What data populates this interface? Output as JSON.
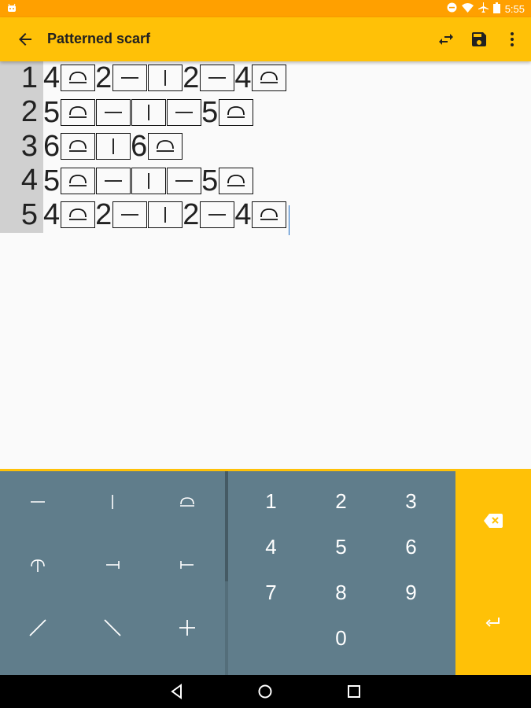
{
  "status": {
    "time": "5:55"
  },
  "toolbar": {
    "title": "Patterned scarf"
  },
  "pattern": {
    "rows": [
      {
        "num": "1",
        "cells": [
          {
            "t": "n",
            "v": "4"
          },
          {
            "t": "s",
            "k": "purl"
          },
          {
            "t": "n",
            "v": "2"
          },
          {
            "t": "s",
            "k": "dash"
          },
          {
            "t": "s",
            "k": "bar"
          },
          {
            "t": "n",
            "v": "2"
          },
          {
            "t": "s",
            "k": "dash"
          },
          {
            "t": "n",
            "v": "4"
          },
          {
            "t": "s",
            "k": "purl"
          }
        ]
      },
      {
        "num": "2",
        "cells": [
          {
            "t": "n",
            "v": "5"
          },
          {
            "t": "s",
            "k": "purl"
          },
          {
            "t": "s",
            "k": "dash"
          },
          {
            "t": "s",
            "k": "bar"
          },
          {
            "t": "s",
            "k": "dash"
          },
          {
            "t": "n",
            "v": "5"
          },
          {
            "t": "s",
            "k": "purl"
          }
        ]
      },
      {
        "num": "3",
        "cells": [
          {
            "t": "n",
            "v": "6"
          },
          {
            "t": "s",
            "k": "purl"
          },
          {
            "t": "s",
            "k": "bar"
          },
          {
            "t": "n",
            "v": "6"
          },
          {
            "t": "s",
            "k": "purl"
          }
        ]
      },
      {
        "num": "4",
        "cells": [
          {
            "t": "n",
            "v": "5"
          },
          {
            "t": "s",
            "k": "purl"
          },
          {
            "t": "s",
            "k": "dash"
          },
          {
            "t": "s",
            "k": "bar"
          },
          {
            "t": "s",
            "k": "dash"
          },
          {
            "t": "n",
            "v": "5"
          },
          {
            "t": "s",
            "k": "purl"
          }
        ]
      },
      {
        "num": "5",
        "cells": [
          {
            "t": "n",
            "v": "4"
          },
          {
            "t": "s",
            "k": "purl"
          },
          {
            "t": "n",
            "v": "2"
          },
          {
            "t": "s",
            "k": "dash"
          },
          {
            "t": "s",
            "k": "bar"
          },
          {
            "t": "n",
            "v": "2"
          },
          {
            "t": "s",
            "k": "dash"
          },
          {
            "t": "n",
            "v": "4"
          },
          {
            "t": "s",
            "k": "purl"
          }
        ]
      }
    ]
  },
  "keyboard": {
    "symbol_keys": [
      {
        "name": "dash-stitch-key",
        "icon": "dash-icon"
      },
      {
        "name": "bar-stitch-key",
        "icon": "bar-icon"
      },
      {
        "name": "purl-stitch-key",
        "icon": "purl-icon"
      },
      {
        "name": "inverted-arc-stitch-key",
        "icon": "arc-down-icon"
      },
      {
        "name": "right-t-stitch-key",
        "icon": "t-right-icon"
      },
      {
        "name": "left-t-stitch-key",
        "icon": "t-left-icon"
      },
      {
        "name": "slash-stitch-key",
        "icon": "slash-icon"
      },
      {
        "name": "backslash-stitch-key",
        "icon": "backslash-icon"
      },
      {
        "name": "plus-stitch-key",
        "icon": "plus-icon"
      }
    ],
    "digits": [
      "1",
      "2",
      "3",
      "4",
      "5",
      "6",
      "7",
      "8",
      "9",
      "0"
    ]
  },
  "colors": {
    "accent": "#ffc107",
    "status": "#ffa000",
    "keyboard": "#607d8b"
  }
}
